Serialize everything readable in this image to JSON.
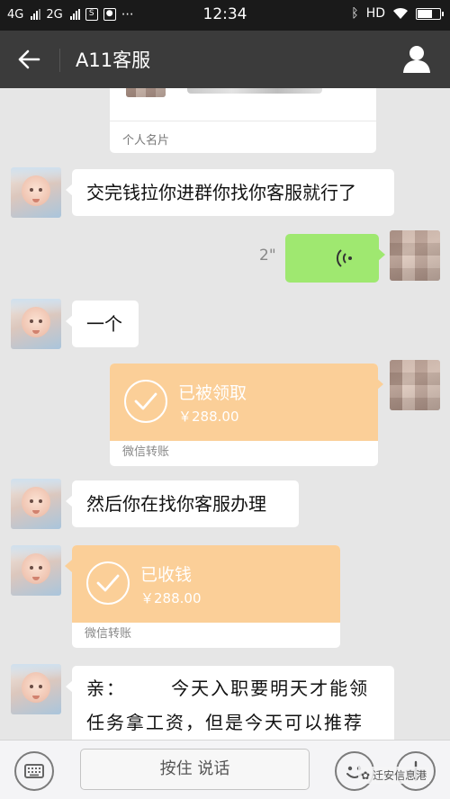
{
  "status_bar": {
    "network_1": "4G",
    "network_2": "2G",
    "time": "12:34",
    "hd": "HD"
  },
  "title_bar": {
    "title": "A11客服"
  },
  "messages": {
    "card_label": "个人名片",
    "msg1": "交完钱拉你进群你找你客服就行了",
    "voice_duration": "2\"",
    "msg2": "一个",
    "transfer1": {
      "status": "已被领取",
      "amount": "￥288.00",
      "label": "微信转账"
    },
    "msg3": "然后你在找你客服办理",
    "transfer2": {
      "status": "已收钱",
      "amount": "￥288.00",
      "label": "微信转账"
    },
    "msg4": "亲：      今天入职要明天才能领任务拿工资，但是今天可以推荐人，可以得到推荐奖励！    每"
  },
  "input_bar": {
    "hold_to_talk": "按住 说话"
  },
  "watermark": "迁安信息港",
  "colors": {
    "status_bar": "#1a1a1a",
    "title_bar": "#3b3b3b",
    "chat_bg": "#e6e6e6",
    "voice_bubble": "#9fe870",
    "transfer": "#fbcf98"
  }
}
